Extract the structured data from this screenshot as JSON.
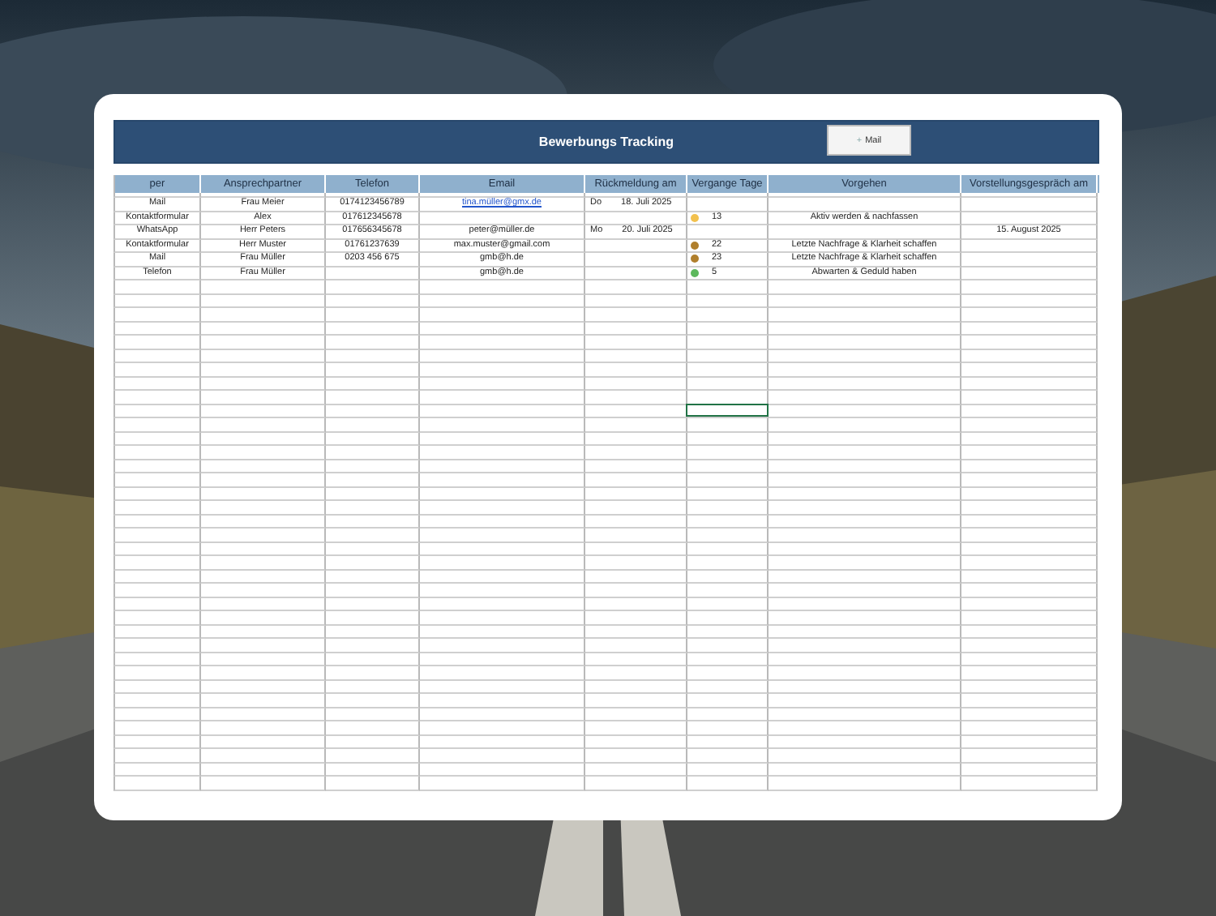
{
  "sheet": {
    "title": "Bewerbungs Tracking",
    "mail_button": {
      "icon": "+",
      "label": "Mail"
    },
    "columns": [
      "per",
      "Ansprechpartner",
      "Telefon",
      "Email",
      "Rückmeldung am",
      "Vergange Tage",
      "Vorgehen",
      "Vorstellungsgespräch am"
    ],
    "rows": [
      {
        "per": "Mail",
        "contact": "Frau Meier",
        "phone": "0174123456789",
        "email": "tina.müller@gmx.de",
        "email_link": true,
        "reply_day": "Do",
        "reply_date": "18. Juli 2025",
        "days": "",
        "color": "",
        "action": "",
        "interview": ""
      },
      {
        "per": "Kontaktformular",
        "contact": "Alex",
        "phone": "017612345678",
        "email": "",
        "email_link": false,
        "reply_day": "",
        "reply_date": "",
        "days": "13",
        "color": "#f2c14e",
        "action": "Aktiv werden & nachfassen",
        "interview": ""
      },
      {
        "per": "WhatsApp",
        "contact": "Herr Peters",
        "phone": "017656345678",
        "email": "peter@müller.de",
        "email_link": false,
        "reply_day": "Mo",
        "reply_date": "20. Juli 2025",
        "days": "",
        "color": "",
        "action": "",
        "interview": "15. August 2025"
      },
      {
        "per": "Kontaktformular",
        "contact": "Herr Muster",
        "phone": "01761237639",
        "email": "max.muster@gmail.com",
        "email_link": false,
        "reply_day": "",
        "reply_date": "",
        "days": "22",
        "color": "#b07f2c",
        "action": "Letzte Nachfrage & Klarheit schaffen",
        "interview": ""
      },
      {
        "per": "Mail",
        "contact": "Frau Müller",
        "phone": "0203 456 675",
        "email": "gmb@h.de",
        "email_link": false,
        "reply_day": "",
        "reply_date": "",
        "days": "23",
        "color": "#b07f2c",
        "action": "Letzte Nachfrage & Klarheit schaffen",
        "interview": ""
      },
      {
        "per": "Telefon",
        "contact": "Frau Müller",
        "phone": "",
        "email": "gmb@h.de",
        "email_link": false,
        "reply_day": "",
        "reply_date": "",
        "days": "5",
        "color": "#5cb85c",
        "action": "Abwarten & Geduld haben",
        "interview": ""
      }
    ],
    "empty_rows": [
      {
        "selected": false
      },
      {
        "selected": false
      },
      {
        "selected": false
      },
      {
        "selected": false
      },
      {
        "selected": false
      },
      {
        "selected": false
      },
      {
        "selected": false
      },
      {
        "selected": false
      },
      {
        "selected": false
      },
      {
        "selected": true
      },
      {
        "selected": false
      },
      {
        "selected": false
      },
      {
        "selected": false
      },
      {
        "selected": false
      },
      {
        "selected": false
      },
      {
        "selected": false
      },
      {
        "selected": false
      },
      {
        "selected": false
      },
      {
        "selected": false
      },
      {
        "selected": false
      },
      {
        "selected": false
      },
      {
        "selected": false
      },
      {
        "selected": false
      },
      {
        "selected": false
      },
      {
        "selected": false
      },
      {
        "selected": false
      },
      {
        "selected": false
      },
      {
        "selected": false
      },
      {
        "selected": false
      },
      {
        "selected": false
      },
      {
        "selected": false
      },
      {
        "selected": false
      },
      {
        "selected": false
      },
      {
        "selected": false
      },
      {
        "selected": false
      },
      {
        "selected": false
      },
      {
        "selected": false
      }
    ]
  }
}
